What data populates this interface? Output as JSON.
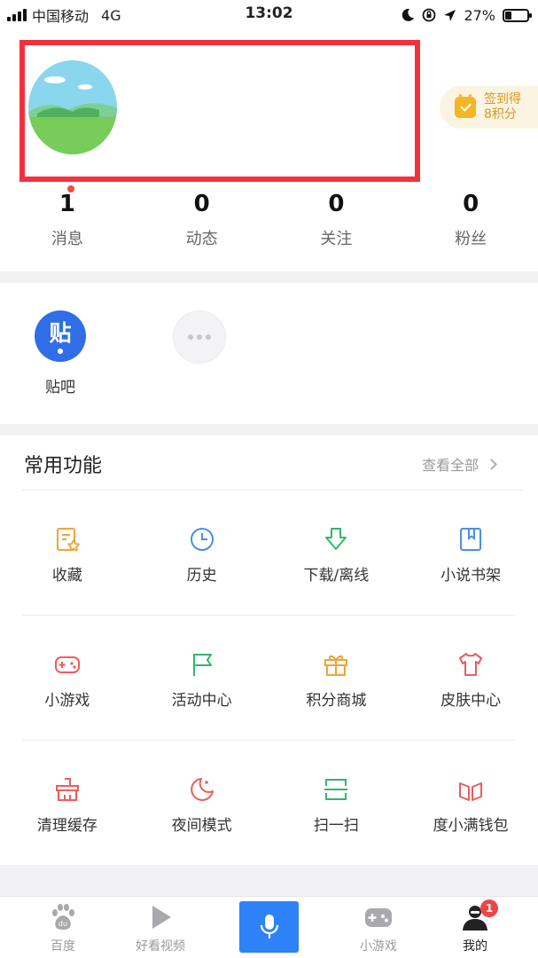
{
  "status_bar": {
    "carrier": "中国移动",
    "network": "4G",
    "time": "13:02",
    "battery": "27%",
    "battery_level": 0.27
  },
  "profile": {
    "checkin_line1": "签到得",
    "checkin_line2": "8积分",
    "stats": [
      {
        "value": "1",
        "label": "消息",
        "has_dot": true
      },
      {
        "value": "0",
        "label": "动态"
      },
      {
        "value": "0",
        "label": "关注"
      },
      {
        "value": "0",
        "label": "粉丝"
      }
    ]
  },
  "apps": {
    "tieba_glyph": "贴",
    "tieba_label": "贴吧",
    "more_icon": "more-dots-icon"
  },
  "common": {
    "title": "常用功能",
    "view_all": "查看全部",
    "items": [
      {
        "label": "收藏",
        "icon": "favorite-icon",
        "color": "#f0a437"
      },
      {
        "label": "历史",
        "icon": "history-clock-icon",
        "color": "#4a8fe8"
      },
      {
        "label": "下载/离线",
        "icon": "download-icon",
        "color": "#34b56a"
      },
      {
        "label": "小说书架",
        "icon": "bookshelf-icon",
        "color": "#4a8fe8"
      },
      {
        "label": "小游戏",
        "icon": "gamepad-icon",
        "color": "#ec5d5d"
      },
      {
        "label": "活动中心",
        "icon": "flag-icon",
        "color": "#34b56a"
      },
      {
        "label": "积分商城",
        "icon": "gift-icon",
        "color": "#f0a437"
      },
      {
        "label": "皮肤中心",
        "icon": "tshirt-icon",
        "color": "#ec5d5d"
      },
      {
        "label": "清理缓存",
        "icon": "broom-icon",
        "color": "#ec5d5d"
      },
      {
        "label": "夜间模式",
        "icon": "moon-icon",
        "color": "#ec5d5d"
      },
      {
        "label": "扫一扫",
        "icon": "scan-icon",
        "color": "#34b56a"
      },
      {
        "label": "度小满钱包",
        "icon": "wallet-icon",
        "color": "#ec5d5d"
      }
    ]
  },
  "bottom_nav": {
    "items": [
      {
        "label": "百度",
        "icon": "baidu-paw-icon"
      },
      {
        "label": "好看视频",
        "icon": "play-icon"
      },
      {
        "label": "",
        "icon": "microphone-icon"
      },
      {
        "label": "小游戏",
        "icon": "gamepad-icon"
      },
      {
        "label": "我的",
        "icon": "profile-icon",
        "active": true
      }
    ],
    "badge": "1"
  },
  "colors": {
    "accent_blue": "#2d82f7",
    "highlight_red": "#f2313f",
    "checkin_gold": "#d79a1c"
  }
}
